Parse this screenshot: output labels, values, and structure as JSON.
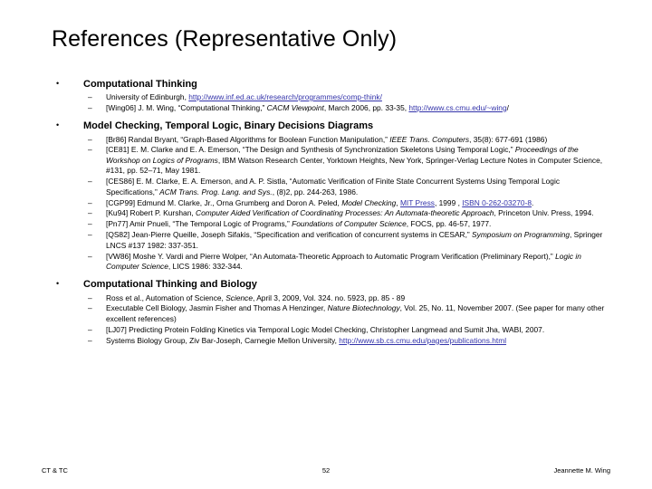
{
  "slide": {
    "title": "References (Representative Only)",
    "bullet_marker": "•",
    "dash_marker": "–"
  },
  "sections": [
    {
      "heading": "Computational Thinking",
      "items": [
        {
          "parts": [
            {
              "type": "text",
              "value": "University of Edinburgh, "
            },
            {
              "type": "link",
              "value": "http://www.inf.ed.ac.uk/research/programmes/comp-think/"
            }
          ]
        },
        {
          "parts": [
            {
              "type": "text",
              "value": "[Wing06] J. M. Wing, “Computational Thinking,” "
            },
            {
              "type": "italic",
              "value": "CACM Viewpoint"
            },
            {
              "type": "text",
              "value": ", March 2006, pp. 33-35, "
            },
            {
              "type": "link",
              "value": "http://www.cs.cmu.edu/~wing"
            },
            {
              "type": "text",
              "value": "/"
            }
          ]
        }
      ]
    },
    {
      "heading": "Model Checking, Temporal Logic, Binary Decisions Diagrams",
      "items": [
        {
          "parts": [
            {
              "type": "text",
              "value": "[Br86] Randal Bryant, “Graph-Based Algorithms for Boolean Function Manipulation,” "
            },
            {
              "type": "italic",
              "value": "IEEE Trans. Computers"
            },
            {
              "type": "text",
              "value": ", 35(8): 677-691 (1986)"
            }
          ]
        },
        {
          "parts": [
            {
              "type": "text",
              "value": "[CE81] E. M. Clarke and E. A. Emerson, “The Design and Synthesis of Synchronization Skeletons Using Temporal Logic,” "
            },
            {
              "type": "italic",
              "value": "Proceedings of the Workshop on Logics of Programs"
            },
            {
              "type": "text",
              "value": ", IBM Watson Research Center, Yorktown Heights, New York, Springer-Verlag Lecture Notes in Computer Science, #131, pp. 52–71, May 1981."
            }
          ]
        },
        {
          "parts": [
            {
              "type": "text",
              "value": "[CES86] E. M. Clarke, E. A. Emerson, and A. P. Sistla, “Automatic Verification of Finite State Concurrent Systems Using Temporal Logic Specifications,” "
            },
            {
              "type": "italic",
              "value": "ACM Trans. Prog. Lang. and Sys."
            },
            {
              "type": "text",
              "value": ", (8)2, pp. 244-263, 1986."
            }
          ]
        },
        {
          "parts": [
            {
              "type": "text",
              "value": "[CGP99] Edmund M. Clarke, Jr., Orna Grumberg and Doron A. Peled, "
            },
            {
              "type": "italic",
              "value": "Model Checking"
            },
            {
              "type": "text",
              "value": ", "
            },
            {
              "type": "link",
              "value": "MIT Press"
            },
            {
              "type": "text",
              "value": ", 1999 , "
            },
            {
              "type": "link",
              "value": "ISBN 0-262-03270-8"
            },
            {
              "type": "text",
              "value": "."
            }
          ]
        },
        {
          "parts": [
            {
              "type": "text",
              "value": "[Ku94] Robert P. Kurshan, "
            },
            {
              "type": "italic",
              "value": "Computer Aided Verification of Coordinating Processes: An Automata-theoretic Approach"
            },
            {
              "type": "text",
              "value": ", Princeton Univ. Press, 1994."
            }
          ]
        },
        {
          "parts": [
            {
              "type": "text",
              "value": "[Pn77] Amir Pnueli, “The Temporal Logic of Programs,”  "
            },
            {
              "type": "italic",
              "value": "Foundations of Computer Science"
            },
            {
              "type": "text",
              "value": ", FOCS, pp. 46-57, 1977."
            }
          ]
        },
        {
          "parts": [
            {
              "type": "text",
              "value": "[QS82] Jean-Pierre Queille, Joseph Sifakis, “Specification and verification of concurrent systems in CESAR,” "
            },
            {
              "type": "italic",
              "value": "Symposium on Programming"
            },
            {
              "type": "text",
              "value": ", Springer LNCS #137 1982: 337-351."
            }
          ]
        },
        {
          "parts": [
            {
              "type": "text",
              "value": "[VW86] Moshe Y. Vardi and Pierre Wolper, “An Automata-Theoretic Approach to Automatic Program Verification (Preliminary Report),” "
            },
            {
              "type": "italic",
              "value": "Logic in Computer Science"
            },
            {
              "type": "text",
              "value": ", LICS 1986: 332-344."
            }
          ]
        }
      ]
    },
    {
      "heading": "Computational Thinking and Biology",
      "items": [
        {
          "parts": [
            {
              "type": "text",
              "value": "Ross et al., Automation of Science, "
            },
            {
              "type": "italic",
              "value": "Science"
            },
            {
              "type": "text",
              "value": ", April 3, 2009, Vol. 324. no. 5923, pp. 85 - 89"
            }
          ]
        },
        {
          "parts": [
            {
              "type": "text",
              "value": "Executable Cell Biology, Jasmin Fisher and Thomas A Henzinger, "
            },
            {
              "type": "italic",
              "value": "Nature Biotechnology"
            },
            {
              "type": "text",
              "value": ", Vol. 25, No. 11, November 2007. (See paper for many other excellent references)"
            }
          ]
        },
        {
          "parts": [
            {
              "type": "text",
              "value": "[LJ07] Predicting Protein Folding Kinetics via Temporal Logic Model Checking, Christopher Langmead and Sumit Jha, WABI, 2007."
            }
          ]
        },
        {
          "parts": [
            {
              "type": "text",
              "value": "Systems Biology Group, Ziv Bar-Joseph, Carnegie Mellon University, "
            },
            {
              "type": "link",
              "value": "http://www.sb.cs.cmu.edu/pages/publications.html"
            }
          ]
        }
      ]
    }
  ],
  "footer": {
    "left": "CT & TC",
    "center": "52",
    "right": "Jeannette M. Wing"
  },
  "colors": {
    "link": "#3333aa",
    "text": "#000000",
    "background": "#ffffff"
  }
}
